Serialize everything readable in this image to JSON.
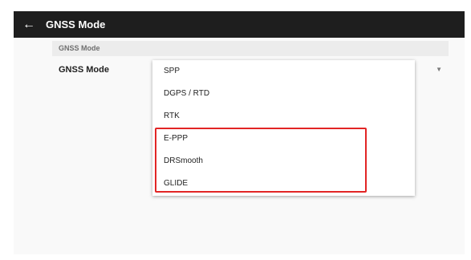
{
  "topbar": {
    "back_icon": "arrow-left-icon",
    "title": "GNSS Mode",
    "color": "#1e1e1e"
  },
  "section": {
    "header": "GNSS Mode"
  },
  "preference": {
    "label": "GNSS Mode",
    "arrow_icon": "triangle-down-icon",
    "arrow_glyph": "▼"
  },
  "dropdown": {
    "options": [
      "SPP",
      "DGPS / RTD",
      "RTK",
      "E-PPP",
      "DRSmooth",
      "GLIDE"
    ]
  },
  "highlight": {
    "color": "#e22525",
    "covers": [
      "E-PPP",
      "DRSmooth",
      "GLIDE"
    ]
  }
}
